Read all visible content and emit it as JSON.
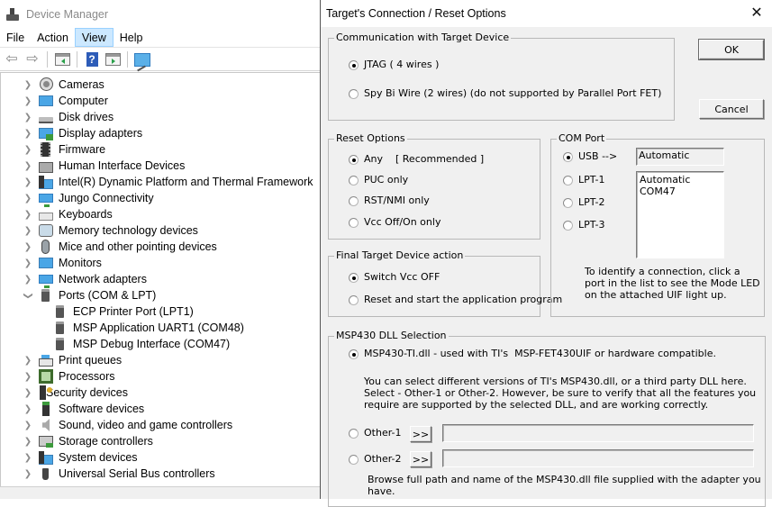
{
  "device_manager": {
    "title": "Device Manager",
    "menu": [
      {
        "label": "File",
        "active": false
      },
      {
        "label": "Action",
        "active": false
      },
      {
        "label": "View",
        "active": true
      },
      {
        "label": "Help",
        "active": false
      }
    ],
    "toolbar": [
      "back-icon",
      "forward-icon",
      "show-hide-console-tree-icon",
      "help-icon",
      "show-action-pane-icon",
      "scan-hardware-icon"
    ],
    "tree": [
      {
        "label": "Cameras",
        "icon": "camera",
        "level": 0,
        "expanded": false
      },
      {
        "label": "Computer",
        "icon": "monitor",
        "level": 0,
        "expanded": false
      },
      {
        "label": "Disk drives",
        "icon": "disk",
        "level": 0,
        "expanded": false
      },
      {
        "label": "Display adapters",
        "icon": "display",
        "level": 0,
        "expanded": false
      },
      {
        "label": "Firmware",
        "icon": "chip",
        "level": 0,
        "expanded": false
      },
      {
        "label": "Human Interface Devices",
        "icon": "hid",
        "level": 0,
        "expanded": false
      },
      {
        "label": "Intel(R) Dynamic Platform and Thermal Framework",
        "icon": "sys",
        "level": 0,
        "expanded": false
      },
      {
        "label": "Jungo Connectivity",
        "icon": "net",
        "level": 0,
        "expanded": false
      },
      {
        "label": "Keyboards",
        "icon": "keyboard",
        "level": 0,
        "expanded": false
      },
      {
        "label": "Memory technology devices",
        "icon": "memory",
        "level": 0,
        "expanded": false
      },
      {
        "label": "Mice and other pointing devices",
        "icon": "mouse",
        "level": 0,
        "expanded": false
      },
      {
        "label": "Monitors",
        "icon": "monitor",
        "level": 0,
        "expanded": false
      },
      {
        "label": "Network adapters",
        "icon": "net",
        "level": 0,
        "expanded": false
      },
      {
        "label": "Ports (COM & LPT)",
        "icon": "port",
        "level": 0,
        "expanded": true
      },
      {
        "label": "ECP Printer Port (LPT1)",
        "icon": "port",
        "level": 1
      },
      {
        "label": "MSP Application UART1 (COM48)",
        "icon": "port",
        "level": 1
      },
      {
        "label": "MSP Debug Interface (COM47)",
        "icon": "port",
        "level": 1
      },
      {
        "label": "Print queues",
        "icon": "printer",
        "level": 0,
        "expanded": false
      },
      {
        "label": "Processors",
        "icon": "cpu",
        "level": 0,
        "expanded": false
      },
      {
        "label": "Security devices",
        "icon": "security",
        "level": 0,
        "expanded": false
      },
      {
        "label": "Software devices",
        "icon": "software",
        "level": 0,
        "expanded": false
      },
      {
        "label": "Sound, video and game controllers",
        "icon": "sound",
        "level": 0,
        "expanded": false
      },
      {
        "label": "Storage controllers",
        "icon": "storage",
        "level": 0,
        "expanded": false
      },
      {
        "label": "System devices",
        "icon": "sys",
        "level": 0,
        "expanded": false
      },
      {
        "label": "Universal Serial Bus controllers",
        "icon": "usb",
        "level": 0,
        "expanded": false
      }
    ]
  },
  "dialog": {
    "title": "Target's Connection / Reset Options",
    "close_glyph": "✕",
    "ok_label": "OK",
    "cancel_label": "Cancel",
    "communication": {
      "legend": "Communication with Target Device",
      "options": [
        {
          "label": "JTAG ( 4 wires )",
          "checked": true
        },
        {
          "label": "Spy Bi Wire (2 wires) (do not supported by Parallel Port FET)",
          "checked": false
        }
      ]
    },
    "reset": {
      "legend": "Reset Options",
      "options": [
        {
          "label": "Any    [ Recommended ]",
          "checked": true
        },
        {
          "label": "PUC only",
          "checked": false
        },
        {
          "label": "RST/NMI only",
          "checked": false
        },
        {
          "label": "Vcc Off/On only",
          "checked": false
        }
      ]
    },
    "final_action": {
      "legend": "Final Target Device action",
      "options": [
        {
          "label": "Switch Vcc OFF",
          "checked": true
        },
        {
          "label": "Reset and start the application program",
          "checked": false
        }
      ]
    },
    "com_port": {
      "legend": "COM Port",
      "options": [
        {
          "label": "USB -->",
          "checked": true
        },
        {
          "label": "LPT-1",
          "checked": false
        },
        {
          "label": "LPT-2",
          "checked": false
        },
        {
          "label": "LPT-3",
          "checked": false
        }
      ],
      "selected_value": "Automatic",
      "list": [
        "Automatic",
        "COM47"
      ],
      "hint": "To identify a connection, click a port in the list to see the Mode LED on the attached UIF light up."
    },
    "dll": {
      "legend": "MSP430 DLL Selection",
      "ti_option": {
        "label": "MSP430-TI.dll - used with TI's  MSP-FET430UIF or hardware compatible.",
        "checked": true
      },
      "info": "You can select different versions of TI's MSP430.dll, or a third party DLL here.  Select - Other-1 or Other-2. However, be sure to verify that all the features you require are supported by the selected DLL, and are working correctly.",
      "other1": {
        "label": "Other-1",
        "checked": false,
        "browse_label": ">>",
        "path": ""
      },
      "other2": {
        "label": "Other-2",
        "checked": false,
        "browse_label": ">>",
        "path": ""
      },
      "browse_hint": "Browse full path and name of the MSP430.dll file supplied with the adapter you have."
    }
  }
}
